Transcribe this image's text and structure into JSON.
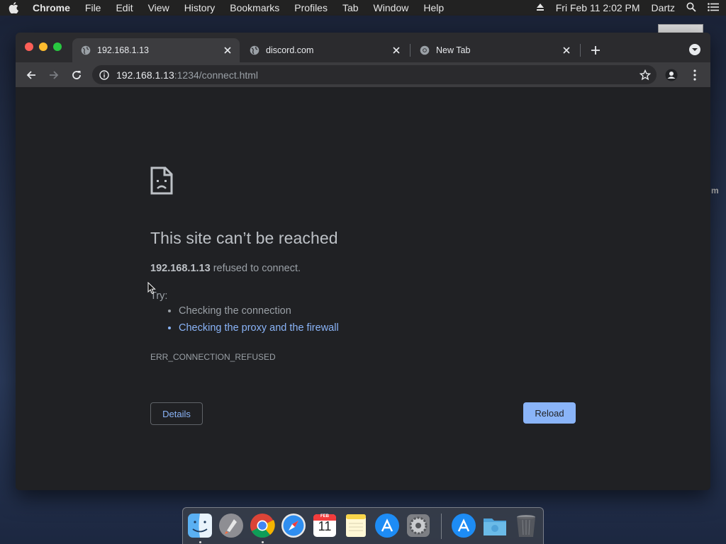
{
  "menubar": {
    "app_name": "Chrome",
    "items": [
      "File",
      "Edit",
      "View",
      "History",
      "Bookmarks",
      "Profiles",
      "Tab",
      "Window",
      "Help"
    ],
    "clock": "Fri Feb 11  2:02 PM",
    "user": "Dartz"
  },
  "desktop": {
    "edge_text": "m"
  },
  "tabs": [
    {
      "title": "192.168.1.13",
      "active": true,
      "icon": "globe-icon"
    },
    {
      "title": "discord.com",
      "active": false,
      "icon": "globe-icon"
    },
    {
      "title": "New Tab",
      "active": false,
      "icon": "chrome-icon"
    }
  ],
  "toolbar": {
    "url_host": "192.168.1.13",
    "url_rest": ":1234/connect.html"
  },
  "error_page": {
    "title": "This site can’t be reached",
    "host": "192.168.1.13",
    "message_suffix": " refused to connect.",
    "try_label": "Try:",
    "suggestions": [
      "Checking the connection",
      "Checking the proxy and the firewall"
    ],
    "error_code": "ERR_CONNECTION_REFUSED",
    "details_label": "Details",
    "reload_label": "Reload"
  },
  "dock": {
    "apps": [
      "Finder",
      "Launchpad",
      "Google Chrome",
      "Safari",
      "Calendar",
      "Notes",
      "App Store",
      "System Preferences",
      "App Store",
      "Downloads",
      "Trash"
    ],
    "calendar_month": "FEB",
    "calendar_day": "11"
  },
  "colors": {
    "accent": "#8ab4f8",
    "page_bg": "#202124",
    "title_text": "#bdc1c6",
    "body_text": "#9aa0a6"
  }
}
